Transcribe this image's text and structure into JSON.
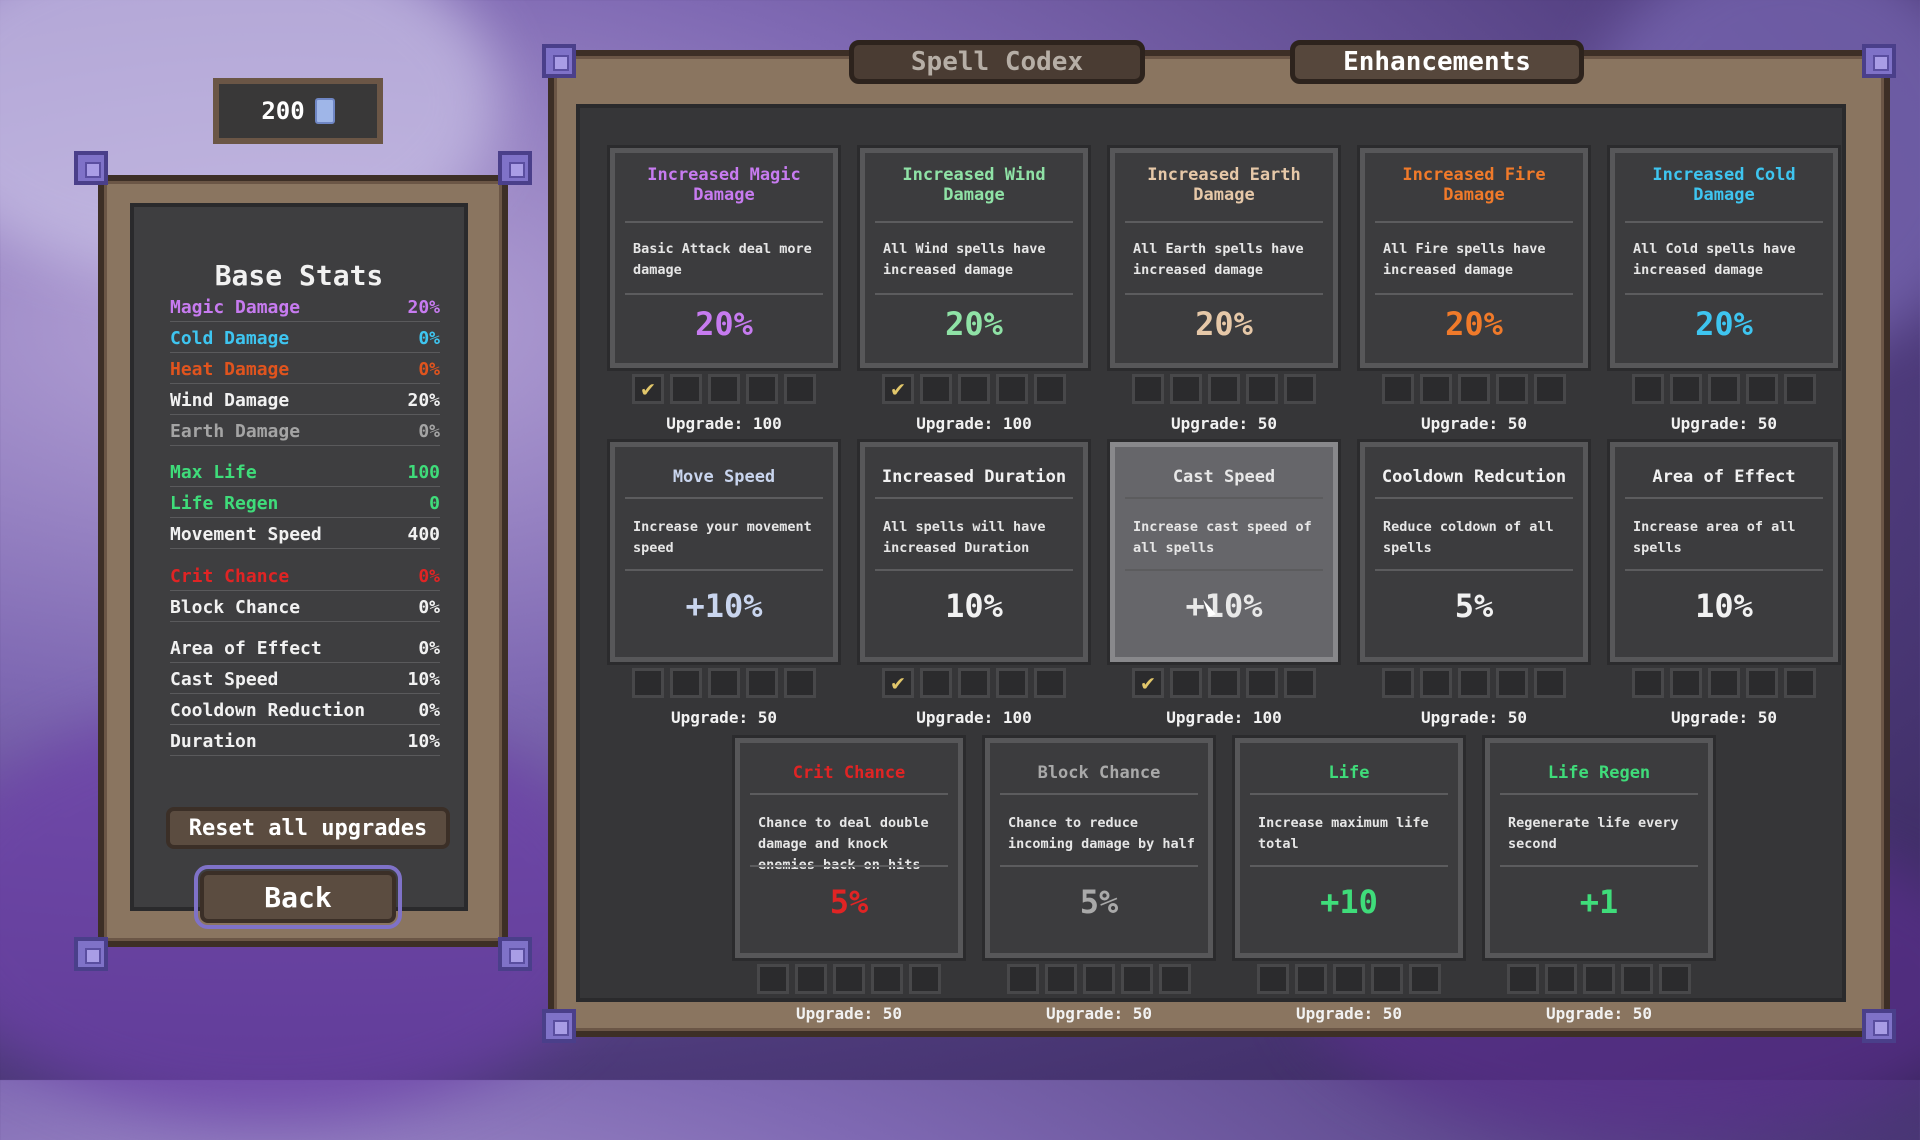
{
  "currency": {
    "amount": "200",
    "icon": "gem-icon"
  },
  "base_stats": {
    "title": "Base Stats",
    "rows": [
      {
        "label": "Magic Damage",
        "value": "20%",
        "color": "#c77bf0"
      },
      {
        "label": "Cold Damage",
        "value": "0%",
        "color": "#3ec5f0"
      },
      {
        "label": "Heat Damage",
        "value": "0%",
        "color": "#e0541e"
      },
      {
        "label": "Wind Damage",
        "value": "20%",
        "color": "#f1f1f1"
      },
      {
        "label": "Earth Damage",
        "value": "0%",
        "color": "#a4a4a4"
      },
      {
        "label": "Max Life",
        "value": "100",
        "color": "#3fdc7a"
      },
      {
        "label": "Life Regen",
        "value": "0",
        "color": "#3fdc7a"
      },
      {
        "label": "Movement Speed",
        "value": "400",
        "color": "#f1f1f1"
      },
      {
        "label": "Crit Chance",
        "value": "0%",
        "color": "#e02424"
      },
      {
        "label": "Block Chance",
        "value": "0%",
        "color": "#f1f1f1"
      },
      {
        "label": "Area of Effect",
        "value": "0%",
        "color": "#f1f1f1"
      },
      {
        "label": "Cast Speed",
        "value": "10%",
        "color": "#f1f1f1"
      },
      {
        "label": "Cooldown Reduction",
        "value": "0%",
        "color": "#f1f1f1"
      },
      {
        "label": "Duration",
        "value": "10%",
        "color": "#f1f1f1"
      }
    ],
    "reset_label": "Reset all upgrades",
    "back_label": "Back"
  },
  "tabs": {
    "codex": "Spell Codex",
    "enhancements": "Enhancements"
  },
  "cards": [
    {
      "title": "Increased Magic Damage",
      "desc": "Basic Attack deal more damage",
      "value": "20%",
      "color": "#c77bf0",
      "val_color": "#c77bf0",
      "filled": 1,
      "upgrade": "Upgrade: 100"
    },
    {
      "title": "Increased Wind Damage",
      "desc": "All Wind spells have increased damage",
      "value": "20%",
      "color": "#8fe2a6",
      "val_color": "#8fe2a6",
      "filled": 1,
      "upgrade": "Upgrade: 100"
    },
    {
      "title": "Increased Earth Damage",
      "desc": "All Earth spells have increased damage",
      "value": "20%",
      "color": "#e6c8a8",
      "val_color": "#e6c8a8",
      "filled": 0,
      "upgrade": "Upgrade: 50"
    },
    {
      "title": "Increased Fire Damage",
      "desc": "All Fire spells have increased damage",
      "value": "20%",
      "color": "#f07a2a",
      "val_color": "#f07a2a",
      "filled": 0,
      "upgrade": "Upgrade: 50"
    },
    {
      "title": "Increased Cold Damage",
      "desc": "All Cold spells have increased damage",
      "value": "20%",
      "color": "#3ec5f0",
      "val_color": "#3ec5f0",
      "filled": 0,
      "upgrade": "Upgrade: 50"
    },
    {
      "title": "Move Speed",
      "desc": "Increase your movement speed",
      "value": "+10%",
      "color": "#c9d5ee",
      "val_color": "#c9d5ee",
      "filled": 0,
      "upgrade": "Upgrade: 50"
    },
    {
      "title": "Increased Duration",
      "desc": "All spells will have increased Duration",
      "value": "10%",
      "color": "#f1f1f1",
      "val_color": "#f1f1f1",
      "filled": 1,
      "upgrade": "Upgrade: 100"
    },
    {
      "title": "Cast Speed",
      "desc": "Increase cast speed of all spells",
      "value": "+10%",
      "color": "#e8e8e8",
      "val_color": "#e8e8e8",
      "filled": 1,
      "upgrade": "Upgrade: 100",
      "highlight": true
    },
    {
      "title": "Cooldown Redcution",
      "desc": "Reduce coldown of all spells",
      "value": "5%",
      "color": "#f1f1f1",
      "val_color": "#f1f1f1",
      "filled": 0,
      "upgrade": "Upgrade: 50"
    },
    {
      "title": "Area of Effect",
      "desc": "Increase area of all spells",
      "value": "10%",
      "color": "#f1f1f1",
      "val_color": "#f1f1f1",
      "filled": 0,
      "upgrade": "Upgrade: 50"
    },
    {
      "title": "Crit Chance",
      "desc": "Chance to deal double damage and knock enemies back on hits",
      "value": "5%",
      "color": "#e02424",
      "val_color": "#e02424",
      "filled": 0,
      "upgrade": "Upgrade: 50"
    },
    {
      "title": "Block Chance",
      "desc": "Chance to reduce incoming damage by half",
      "value": "5%",
      "color": "#a9a9a9",
      "val_color": "#a9a9a9",
      "filled": 0,
      "upgrade": "Upgrade: 50"
    },
    {
      "title": "Life",
      "desc": "Increase maximum life total",
      "value": "+10",
      "color": "#3fdc7a",
      "val_color": "#3fdc7a",
      "filled": 0,
      "upgrade": "Upgrade: 50"
    },
    {
      "title": "Life Regen",
      "desc": "Regenerate life every second",
      "value": "+1",
      "color": "#3fdc7a",
      "val_color": "#3fdc7a",
      "filled": 0,
      "upgrade": "Upgrade: 50"
    }
  ]
}
